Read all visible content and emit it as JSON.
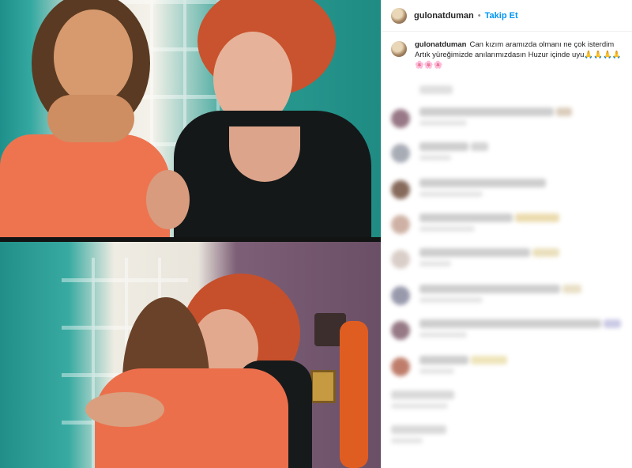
{
  "post": {
    "username": "gulonatduman",
    "separator": "•",
    "follow_label": "Takip Et"
  },
  "caption": {
    "username": "gulonatduman",
    "text": "Can kızım aramızda olmanı ne çok isterdim Artık yüreğimizde anılarımızdasın Huzur içinde uyu🙏🙏🙏🙏🌸🌸🌸"
  },
  "colors": {
    "link": "#0095f6",
    "text": "#262626",
    "divider": "#efefef"
  },
  "icons": [
    "avatar",
    "comment-avatar"
  ]
}
